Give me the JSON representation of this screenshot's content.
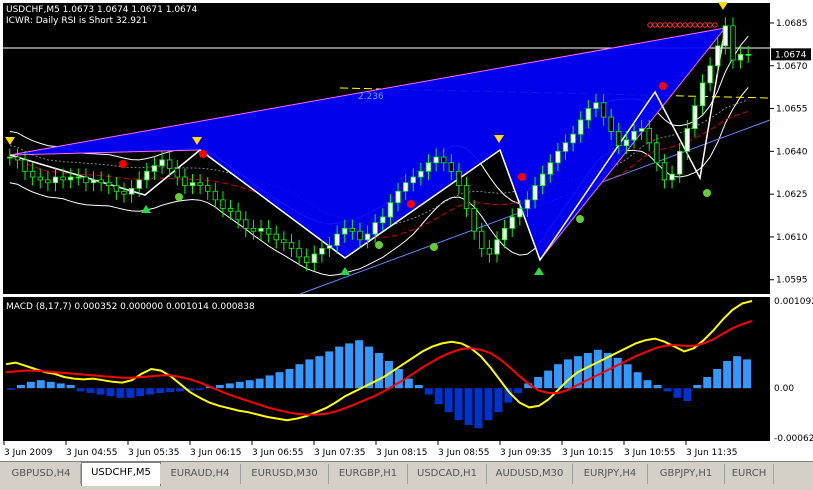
{
  "colors": {
    "background": "#000000",
    "axis_bg": "#ffffff",
    "candle_up": "#ffffff",
    "candle_down": "#000000",
    "wick": "#00ff00",
    "pattern_fill": "#0000ff",
    "macd_hist_up": "#3399ff",
    "macd_hist_down": "#0033cc",
    "macd_signal": "#ff0000",
    "macd_line": "#ffff00"
  },
  "chart_header": {
    "symbol_line": "USDCHF,M5  1.0673 1.0674 1.0671 1.0674",
    "indicator_line": "ICWR: Daily RSI is Short 32.921",
    "fib_label": "2.236"
  },
  "price_panel": {
    "price_ticks": [
      "1.0685",
      "1.0670",
      "1.0655",
      "1.0640",
      "1.0625",
      "1.0610",
      "1.0595"
    ],
    "price_tick_values": [
      1.0685,
      1.067,
      1.0655,
      1.064,
      1.0625,
      1.061,
      1.0595
    ],
    "current_price_label": "1.0674",
    "current_price": 1.0674,
    "ylim": [
      1.059,
      1.0692
    ]
  },
  "macd_panel": {
    "title": "MACD  (8,17,7) 0.000352 0.000000 0.001014 0.000838",
    "ticks": [
      "0.001092",
      "0.00",
      "-0.00062"
    ],
    "tick_values": [
      0.001092,
      0.0,
      -0.00062
    ],
    "ylim": [
      -0.00066,
      0.00114
    ]
  },
  "x_axis": {
    "labels": [
      "3 Jun 2009",
      "3 Jun 04:55",
      "3 Jun 05:35",
      "3 Jun 06:15",
      "3 Jun 06:55",
      "3 Jun 07:35",
      "3 Jun 08:15",
      "3 Jun 08:55",
      "3 Jun 09:35",
      "3 Jun 10:15",
      "3 Jun 10:55",
      "3 Jun 11:35"
    ]
  },
  "chart_data": {
    "type": "line",
    "xlabel": "",
    "ylabel": "",
    "grid": false,
    "price_close": [
      1.0638,
      1.0637,
      1.0633,
      1.0631,
      1.063,
      1.0629,
      1.0631,
      1.063,
      1.0631,
      1.0631,
      1.0629,
      1.063,
      1.0629,
      1.0628,
      1.0626,
      1.0625,
      1.0627,
      1.063,
      1.0633,
      1.0635,
      1.0637,
      1.0634,
      1.0631,
      1.0628,
      1.0629,
      1.0628,
      1.0626,
      1.0623,
      1.062,
      1.0619,
      1.0616,
      1.0613,
      1.0612,
      1.0613,
      1.0611,
      1.0609,
      1.0608,
      1.0606,
      1.0603,
      1.0601,
      1.0604,
      1.0606,
      1.0607,
      1.0611,
      1.0613,
      1.0612,
      1.0609,
      1.0611,
      1.0615,
      1.0617,
      1.0622,
      1.0626,
      1.0629,
      1.0631,
      1.0633,
      1.0636,
      1.0638,
      1.0636,
      1.0633,
      1.0628,
      1.062,
      1.0612,
      1.0606,
      1.0604,
      1.0609,
      1.0613,
      1.0617,
      1.062,
      1.0623,
      1.0628,
      1.0632,
      1.0636,
      1.064,
      1.0643,
      1.0646,
      1.0651,
      1.0655,
      1.0657,
      1.0652,
      1.0647,
      1.0642,
      1.0644,
      1.0647,
      1.0648,
      1.0643,
      1.0636,
      1.063,
      1.0632,
      1.064,
      1.0648,
      1.0656,
      1.0664,
      1.067,
      1.0677,
      1.0684,
      1.0672,
      1.0674,
      1.0674
    ],
    "series": [
      {
        "name": "MACD",
        "values": [
          0.0003,
          0.00032,
          0.00028,
          0.00024,
          0.0002,
          0.00018,
          0.00014,
          0.00012,
          0.00011,
          0.00012,
          0.0001,
          8e-05,
          7e-05,
          0.0001,
          0.00018,
          0.00024,
          0.00022,
          0.00015,
          5e-05,
          -5e-05,
          -0.00012,
          -0.00018,
          -0.00022,
          -0.00025,
          -0.00028,
          -0.0003,
          -0.00033,
          -0.00036,
          -0.00038,
          -0.0004,
          -0.00038,
          -0.00035,
          -0.0003,
          -0.00025,
          -0.00018,
          -0.0001,
          -4e-05,
          2e-05,
          8e-05,
          0.00014,
          0.00022,
          0.0003,
          0.00038,
          0.00046,
          0.00052,
          0.00056,
          0.00058,
          0.00056,
          0.0005,
          0.0004,
          0.00026,
          0.0001,
          -6e-05,
          -0.00018,
          -0.00024,
          -0.00022,
          -0.00014,
          -2e-05,
          0.0001,
          0.0002,
          0.00026,
          0.00032,
          0.00038,
          0.00044,
          0.0005,
          0.00056,
          0.0006,
          0.00062,
          0.00058,
          0.00052,
          0.00046,
          0.0005,
          0.0006,
          0.00072,
          0.00086,
          0.00098,
          0.00106,
          0.00109
        ]
      },
      {
        "name": "Signal",
        "values": [
          0.0002,
          0.00021,
          0.00022,
          0.00022,
          0.00021,
          0.0002,
          0.00019,
          0.00018,
          0.00017,
          0.00016,
          0.00015,
          0.00014,
          0.00013,
          0.00013,
          0.00014,
          0.00015,
          0.00016,
          0.00016,
          0.00014,
          0.00011,
          7e-05,
          2e-05,
          -3e-05,
          -8e-05,
          -0.00012,
          -0.00016,
          -0.0002,
          -0.00024,
          -0.00027,
          -0.0003,
          -0.00032,
          -0.00033,
          -0.00033,
          -0.00032,
          -0.00029,
          -0.00025,
          -0.0002,
          -0.00015,
          -0.0001,
          -4e-05,
          3e-05,
          0.0001,
          0.00018,
          0.00026,
          0.00033,
          0.0004,
          0.00045,
          0.00049,
          0.0005,
          0.00048,
          0.00044,
          0.00036,
          0.00026,
          0.00015,
          5e-05,
          -3e-05,
          -6e-05,
          -6e-05,
          -2e-05,
          4e-05,
          0.0001,
          0.00016,
          0.00022,
          0.00028,
          0.00034,
          0.0004,
          0.00045,
          0.0005,
          0.00053,
          0.00054,
          0.00053,
          0.00053,
          0.00056,
          0.00061,
          0.00068,
          0.00075,
          0.0008,
          0.00084
        ]
      }
    ],
    "histogram": [
      -2e-05,
      4e-05,
      8e-05,
      0.0001,
      8e-05,
      6e-05,
      4e-05,
      -4e-05,
      -6e-05,
      -8e-05,
      -0.0001,
      -0.00012,
      -0.00012,
      -0.0001,
      -8e-05,
      -6e-05,
      -5e-05,
      -4e-05,
      -3e-05,
      -2e-05,
      2e-05,
      4e-05,
      6e-05,
      8e-05,
      0.0001,
      0.00012,
      0.00016,
      0.0002,
      0.00024,
      0.0003,
      0.00036,
      0.0004,
      0.00046,
      0.00052,
      0.00056,
      0.0006,
      0.00052,
      0.00044,
      0.00034,
      0.00024,
      0.00012,
      4e-05,
      -8e-05,
      -0.0002,
      -0.0003,
      -0.0004,
      -0.00046,
      -0.0005,
      -0.0004,
      -0.0003,
      -0.00018,
      -6e-05,
      6e-05,
      0.00014,
      0.00022,
      0.0003,
      0.00036,
      0.0004,
      0.00044,
      0.00048,
      0.00044,
      0.00038,
      0.0003,
      0.0002,
      0.0001,
      4e-05,
      -4e-05,
      -0.00012,
      -0.00016,
      4e-05,
      0.00014,
      0.00024,
      0.00034,
      0.0004,
      0.00036
    ]
  },
  "tabs": [
    {
      "label": "GBPUSD,H4",
      "active": false
    },
    {
      "label": "USDCHF,M5",
      "active": true
    },
    {
      "label": "EURAUD,H4",
      "active": false
    },
    {
      "label": "EURUSD,M30",
      "active": false
    },
    {
      "label": "EURGBP,H1",
      "active": false
    },
    {
      "label": "USDCAD,H1",
      "active": false
    },
    {
      "label": "AUDUSD,M30",
      "active": false
    },
    {
      "label": "EURJPY,H4",
      "active": false
    },
    {
      "label": "GBPJPY,H1",
      "active": false
    },
    {
      "label": "EURCH",
      "active": false
    }
  ]
}
